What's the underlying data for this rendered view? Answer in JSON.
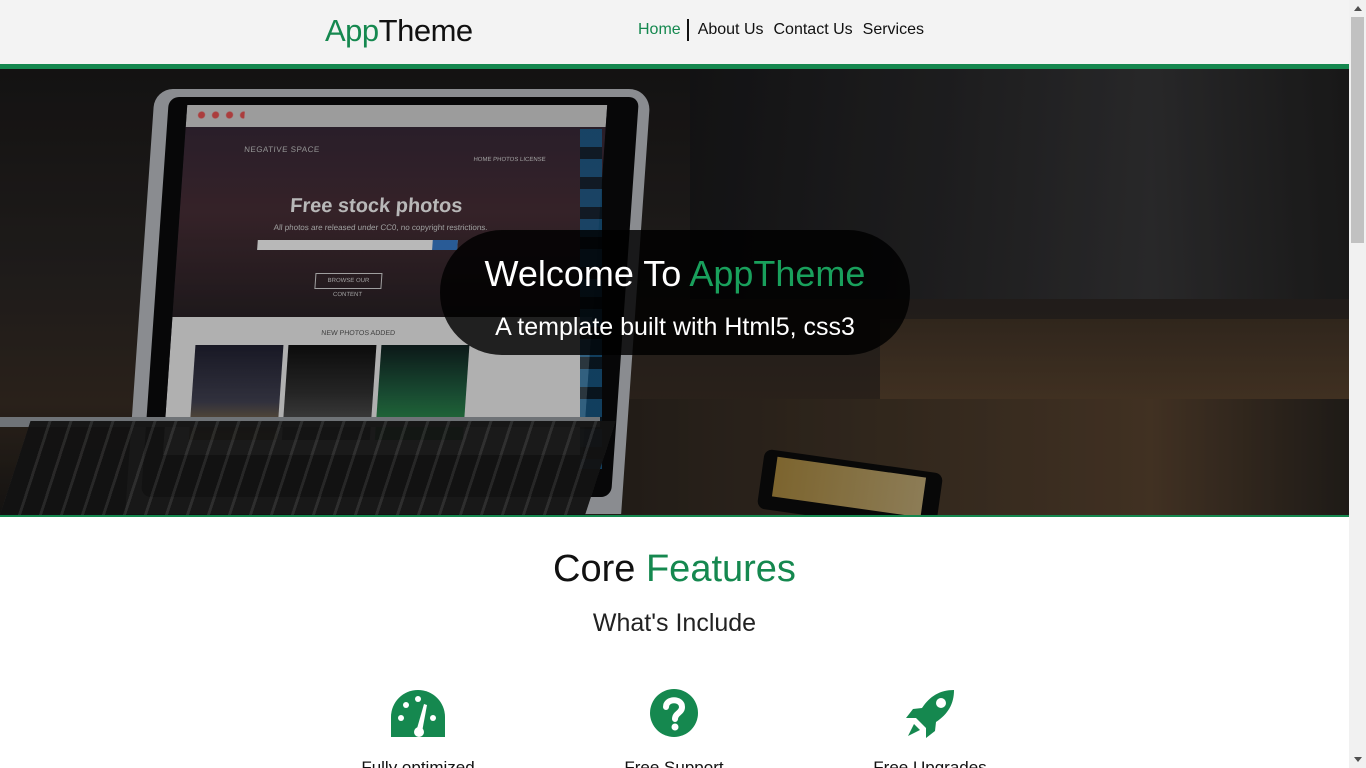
{
  "header": {
    "logo_part1": "App",
    "logo_part2": "Theme",
    "nav": [
      {
        "label": "Home",
        "active": true
      },
      {
        "label": "About Us",
        "active": false
      },
      {
        "label": "Contact Us",
        "active": false
      },
      {
        "label": "Services",
        "active": false
      }
    ]
  },
  "hero": {
    "welcome_prefix": "Welcome To ",
    "welcome_brand": "AppTheme",
    "tagline": "A template built with Html5, css3",
    "screen_title": "Free stock photos",
    "screen_subtitle": "All photos are released under CC0, no copyright restrictions.",
    "screen_brand": "NEGATIVE SPACE",
    "screen_menu": "HOME   PHOTOS   LICENSE",
    "screen_cta": "BROWSE OUR CONTENT",
    "screen_section": "NEW PHOTOS ADDED"
  },
  "features": {
    "title_prefix": "Core ",
    "title_accent": "Features",
    "subtitle": "What's Include",
    "items": [
      {
        "label": "Fully optimized",
        "icon": "speedometer-icon"
      },
      {
        "label": "Free Support",
        "icon": "question-circle-icon"
      },
      {
        "label": "Free Upgrades",
        "icon": "rocket-icon"
      }
    ]
  },
  "colors": {
    "accent": "#15884f",
    "header_bg": "#f3f3f3"
  }
}
